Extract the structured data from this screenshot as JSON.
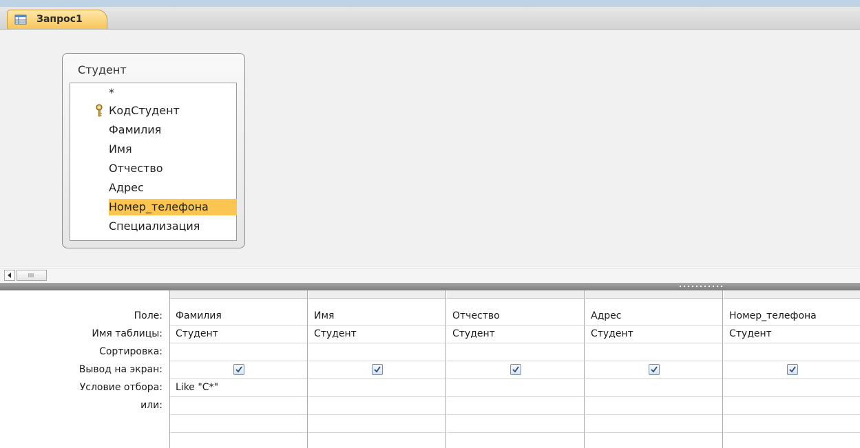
{
  "tab": {
    "label": "Запрос1",
    "icon": "query-icon"
  },
  "source_table": {
    "title": "Студент",
    "fields": [
      "*",
      "КодСтудент",
      "Фамилия",
      "Имя",
      "Отчество",
      "Адрес",
      "Номер_телефона",
      "Специализация"
    ],
    "primary_key_field": "КодСтудент",
    "selected_field": "Номер_телефона"
  },
  "grid": {
    "row_labels": {
      "field": "Поле:",
      "table": "Имя таблицы:",
      "sort": "Сортировка:",
      "show": "Вывод на экран:",
      "criteria": "Условие отбора:",
      "or": "или:"
    },
    "columns": [
      {
        "field": "Фамилия",
        "table": "Студент",
        "sort": "",
        "show": true,
        "criteria": "Like \"С*\"",
        "or": ""
      },
      {
        "field": "Имя",
        "table": "Студент",
        "sort": "",
        "show": true,
        "criteria": "",
        "or": ""
      },
      {
        "field": "Отчество",
        "table": "Студент",
        "sort": "",
        "show": true,
        "criteria": "",
        "or": ""
      },
      {
        "field": "Адрес",
        "table": "Студент",
        "sort": "",
        "show": true,
        "criteria": "",
        "or": ""
      },
      {
        "field": "Номер_телефона",
        "table": "Студент",
        "sort": "",
        "show": true,
        "criteria": "",
        "or": ""
      }
    ]
  },
  "colors": {
    "selection": "#fbc552",
    "tab": "#f7c65d"
  }
}
